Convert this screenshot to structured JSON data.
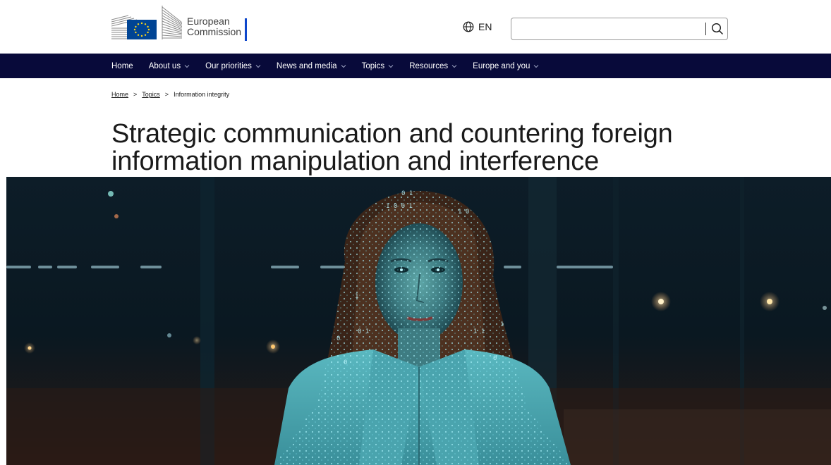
{
  "header": {
    "logo": {
      "line1": "European",
      "line2": "Commission",
      "brand_blue": "#004494",
      "star_yellow": "#ffd617",
      "accent_bar": "#0e47cb"
    },
    "language": {
      "icon": "globe-icon",
      "code": "EN"
    },
    "search": {
      "value": "",
      "placeholder": "",
      "icon": "search-icon"
    }
  },
  "nav": {
    "background": "#080a3a",
    "items": [
      {
        "label": "Home",
        "has_dropdown": false
      },
      {
        "label": "About us",
        "has_dropdown": true
      },
      {
        "label": "Our priorities",
        "has_dropdown": true
      },
      {
        "label": "News and media",
        "has_dropdown": true
      },
      {
        "label": "Topics",
        "has_dropdown": true
      },
      {
        "label": "Resources",
        "has_dropdown": true
      },
      {
        "label": "Europe and you",
        "has_dropdown": true
      }
    ]
  },
  "breadcrumb": {
    "items": [
      "Home",
      "Topics",
      "Information integrity"
    ],
    "separator": ">"
  },
  "page": {
    "title_line1": "Strategic communication and countering foreign",
    "title_line2": "information manipulation and interference"
  },
  "hero": {
    "icon": "hero-image"
  }
}
